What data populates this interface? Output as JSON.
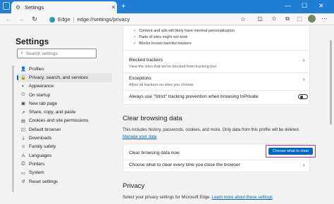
{
  "browser": {
    "tab_title": "Settings",
    "tab_close": "✕",
    "new_tab": "+",
    "site_label": "Edge",
    "separator": "|",
    "url": "edge://settings/privacy",
    "window_controls": [
      "—",
      "☐",
      "✕"
    ],
    "more_menu": "···"
  },
  "sidebar": {
    "title": "Settings",
    "search_placeholder": "Search settings",
    "items": [
      {
        "label": "Profiles",
        "icon": "person-icon",
        "glyph": "👤",
        "active": false
      },
      {
        "label": "Privacy, search, and services",
        "icon": "lock-icon",
        "glyph": "🔒",
        "active": true
      },
      {
        "label": "Appearance",
        "icon": "appearance-icon",
        "glyph": "◐",
        "active": false
      },
      {
        "label": "On startup",
        "icon": "power-icon",
        "glyph": "⏻",
        "active": false
      },
      {
        "label": "New tab page",
        "icon": "newtab-icon",
        "glyph": "▣",
        "active": false
      },
      {
        "label": "Share, copy, and paste",
        "icon": "share-icon",
        "glyph": "↗",
        "active": false
      },
      {
        "label": "Cookies and site permissions",
        "icon": "cookie-icon",
        "glyph": "▤",
        "active": false
      },
      {
        "label": "Default browser",
        "icon": "browser-icon",
        "glyph": "◫",
        "active": false
      },
      {
        "label": "Downloads",
        "icon": "download-icon",
        "glyph": "⤓",
        "active": false
      },
      {
        "label": "Family safety",
        "icon": "family-icon",
        "glyph": "☺",
        "active": false
      },
      {
        "label": "Languages",
        "icon": "languages-icon",
        "glyph": "A",
        "active": false
      },
      {
        "label": "Printers",
        "icon": "printer-icon",
        "glyph": "⎙",
        "active": false
      },
      {
        "label": "System",
        "icon": "system-icon",
        "glyph": "▭",
        "active": false
      },
      {
        "label": "Reset settings",
        "icon": "reset-icon",
        "glyph": "↺",
        "active": false
      }
    ]
  },
  "tracking": {
    "bullets": [
      "Content and ads will likely have minimal personalization",
      "Parts of sites might not work",
      "Blocks known harmful trackers"
    ],
    "blocked_title": "Blocked trackers",
    "blocked_sub": "View the sites that we've blocked from tracking you",
    "exceptions_title": "Exceptions",
    "exceptions_sub": "Allow all trackers on sites you choose",
    "strict_label": "Always use \"Strict\" tracking prevention when browsing InPrivate"
  },
  "clear": {
    "title": "Clear browsing data",
    "description": "This includes history, passwords, cookies, and more. Only data from this profile will be deleted.",
    "manage_link": "Manage your data",
    "clear_now_label": "Clear browsing data now",
    "button_label": "Choose what to clear",
    "close_label": "Choose what to clear every time you close the browser"
  },
  "privacy": {
    "title": "Privacy",
    "description": "Select your privacy settings for Microsoft Edge.",
    "link": "Learn more about these settings"
  },
  "colors": {
    "accent": "#0067c0",
    "tabbar": "#1f7fd6",
    "highlight": "#d91ec8"
  }
}
